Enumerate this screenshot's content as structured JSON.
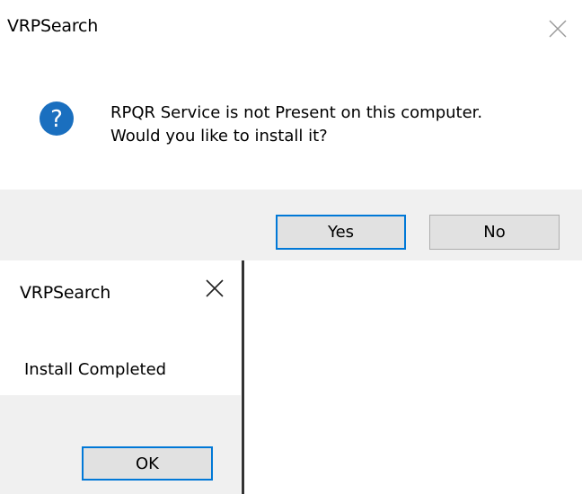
{
  "dialog_question": {
    "title": "VRPSearch",
    "icon": "question-icon",
    "message_line1": "RPQR Service is not Present on this computer.",
    "message_line2": "Would you like to install it?",
    "buttons": {
      "yes": "Yes",
      "no": "No"
    }
  },
  "dialog_complete": {
    "title": "VRPSearch",
    "message": "Install Completed",
    "buttons": {
      "ok": "OK"
    }
  },
  "colors": {
    "icon_blue": "#1a6fbf",
    "button_bar": "#f0f0f0",
    "default_button_border": "#0078d7"
  }
}
